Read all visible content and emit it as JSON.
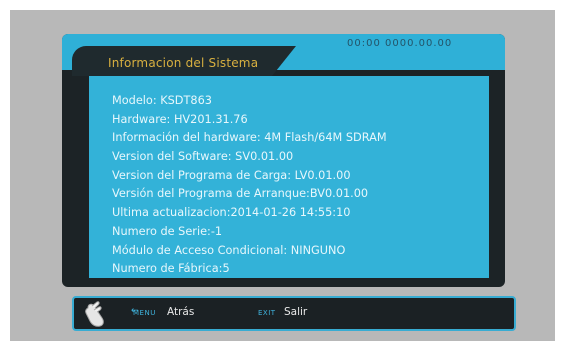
{
  "header": {
    "title": "Informacion del Sistema",
    "clock": "00:00 0000.00.00"
  },
  "info_lines": [
    "Modelo: KSDT863",
    "Hardware: HV201.31.76",
    "Información del hardware: 4M Flash/64M SDRAM",
    "Version del Software: SV0.01.00",
    "Version del Programa de Carga: LV0.01.00",
    "Versión del Programa de Arranque:BV0.01.00",
    "Ultima actualizacion:2014-01-26 14:55:10",
    "Numero de Serie:-1",
    "Módulo de Acceso Condicional: NINGUNO",
    "Numero de Fábrica:5"
  ],
  "footer": {
    "menu_key": "MENU",
    "menu_label": "Atrás",
    "exit_key": "EXIT",
    "exit_label": "Salir"
  },
  "colors": {
    "accent": "#33b2d8",
    "panel": "#1c2326",
    "title": "#d8b040"
  }
}
